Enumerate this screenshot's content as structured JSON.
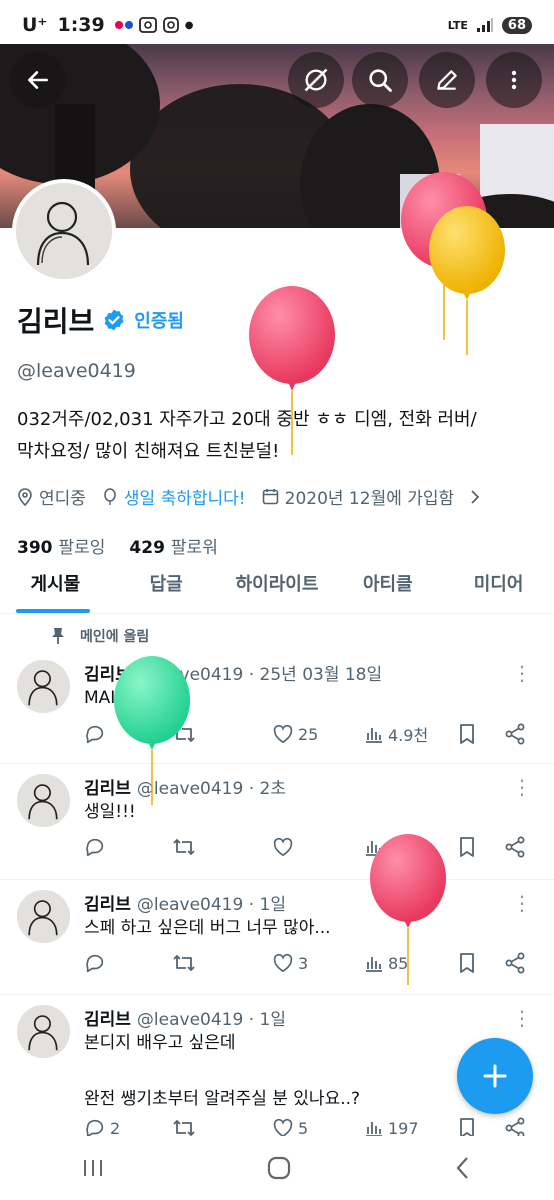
{
  "status_bar": {
    "carrier": "U⁺",
    "time": "1:39",
    "network": "LTE",
    "battery": "68"
  },
  "profile": {
    "name": "김리브",
    "verified_label": "인증됨",
    "handle": "@leave0419",
    "bio_line1": "032거주/02,031 자주가고 20대 중반 ㅎㅎ 디엠, 전화 러버/",
    "bio_line2": "막차요정/  많이 친해져요 트친분덜!",
    "location": "연디중",
    "birthday": "생일 축하합니다!",
    "joined": "2020년 12월에 가입함",
    "following_count": "390",
    "following_label": "팔로잉",
    "followers_count": "429",
    "followers_label": "팔로워"
  },
  "tabs": [
    "게시물",
    "답글",
    "하이라이트",
    "아티클",
    "미디어"
  ],
  "pinned_label": "메인에 올림",
  "posts": [
    {
      "name": "김리브",
      "meta": "@leave0419 · 25년 03월 18일",
      "text": "MAIN.",
      "replies": "",
      "retweets": "",
      "likes": "25",
      "views": "4.9천"
    },
    {
      "name": "김리브",
      "meta": "@leave0419 · 2초",
      "text": "생일!!!",
      "replies": "",
      "retweets": "",
      "likes": "",
      "views": ""
    },
    {
      "name": "김리브",
      "meta": "@leave0419 · 1일",
      "text": "스페 하고 싶은데 버그 너무 많아...",
      "replies": "",
      "retweets": "",
      "likes": "3",
      "views": "85"
    },
    {
      "name": "김리브",
      "meta": "@leave0419 · 1일",
      "text": "본디지 배우고 싶은데\n\n완전 쌩기초부터 알려주실 분 있나요..?",
      "replies": "2",
      "retweets": "",
      "likes": "5",
      "views": "197"
    }
  ],
  "colors": {
    "accent": "#1d9bf0",
    "secondary_text": "#536471",
    "balloon_red": "#f0506e",
    "balloon_yellow": "#f5c21b",
    "balloon_green": "#3ee0a0"
  }
}
